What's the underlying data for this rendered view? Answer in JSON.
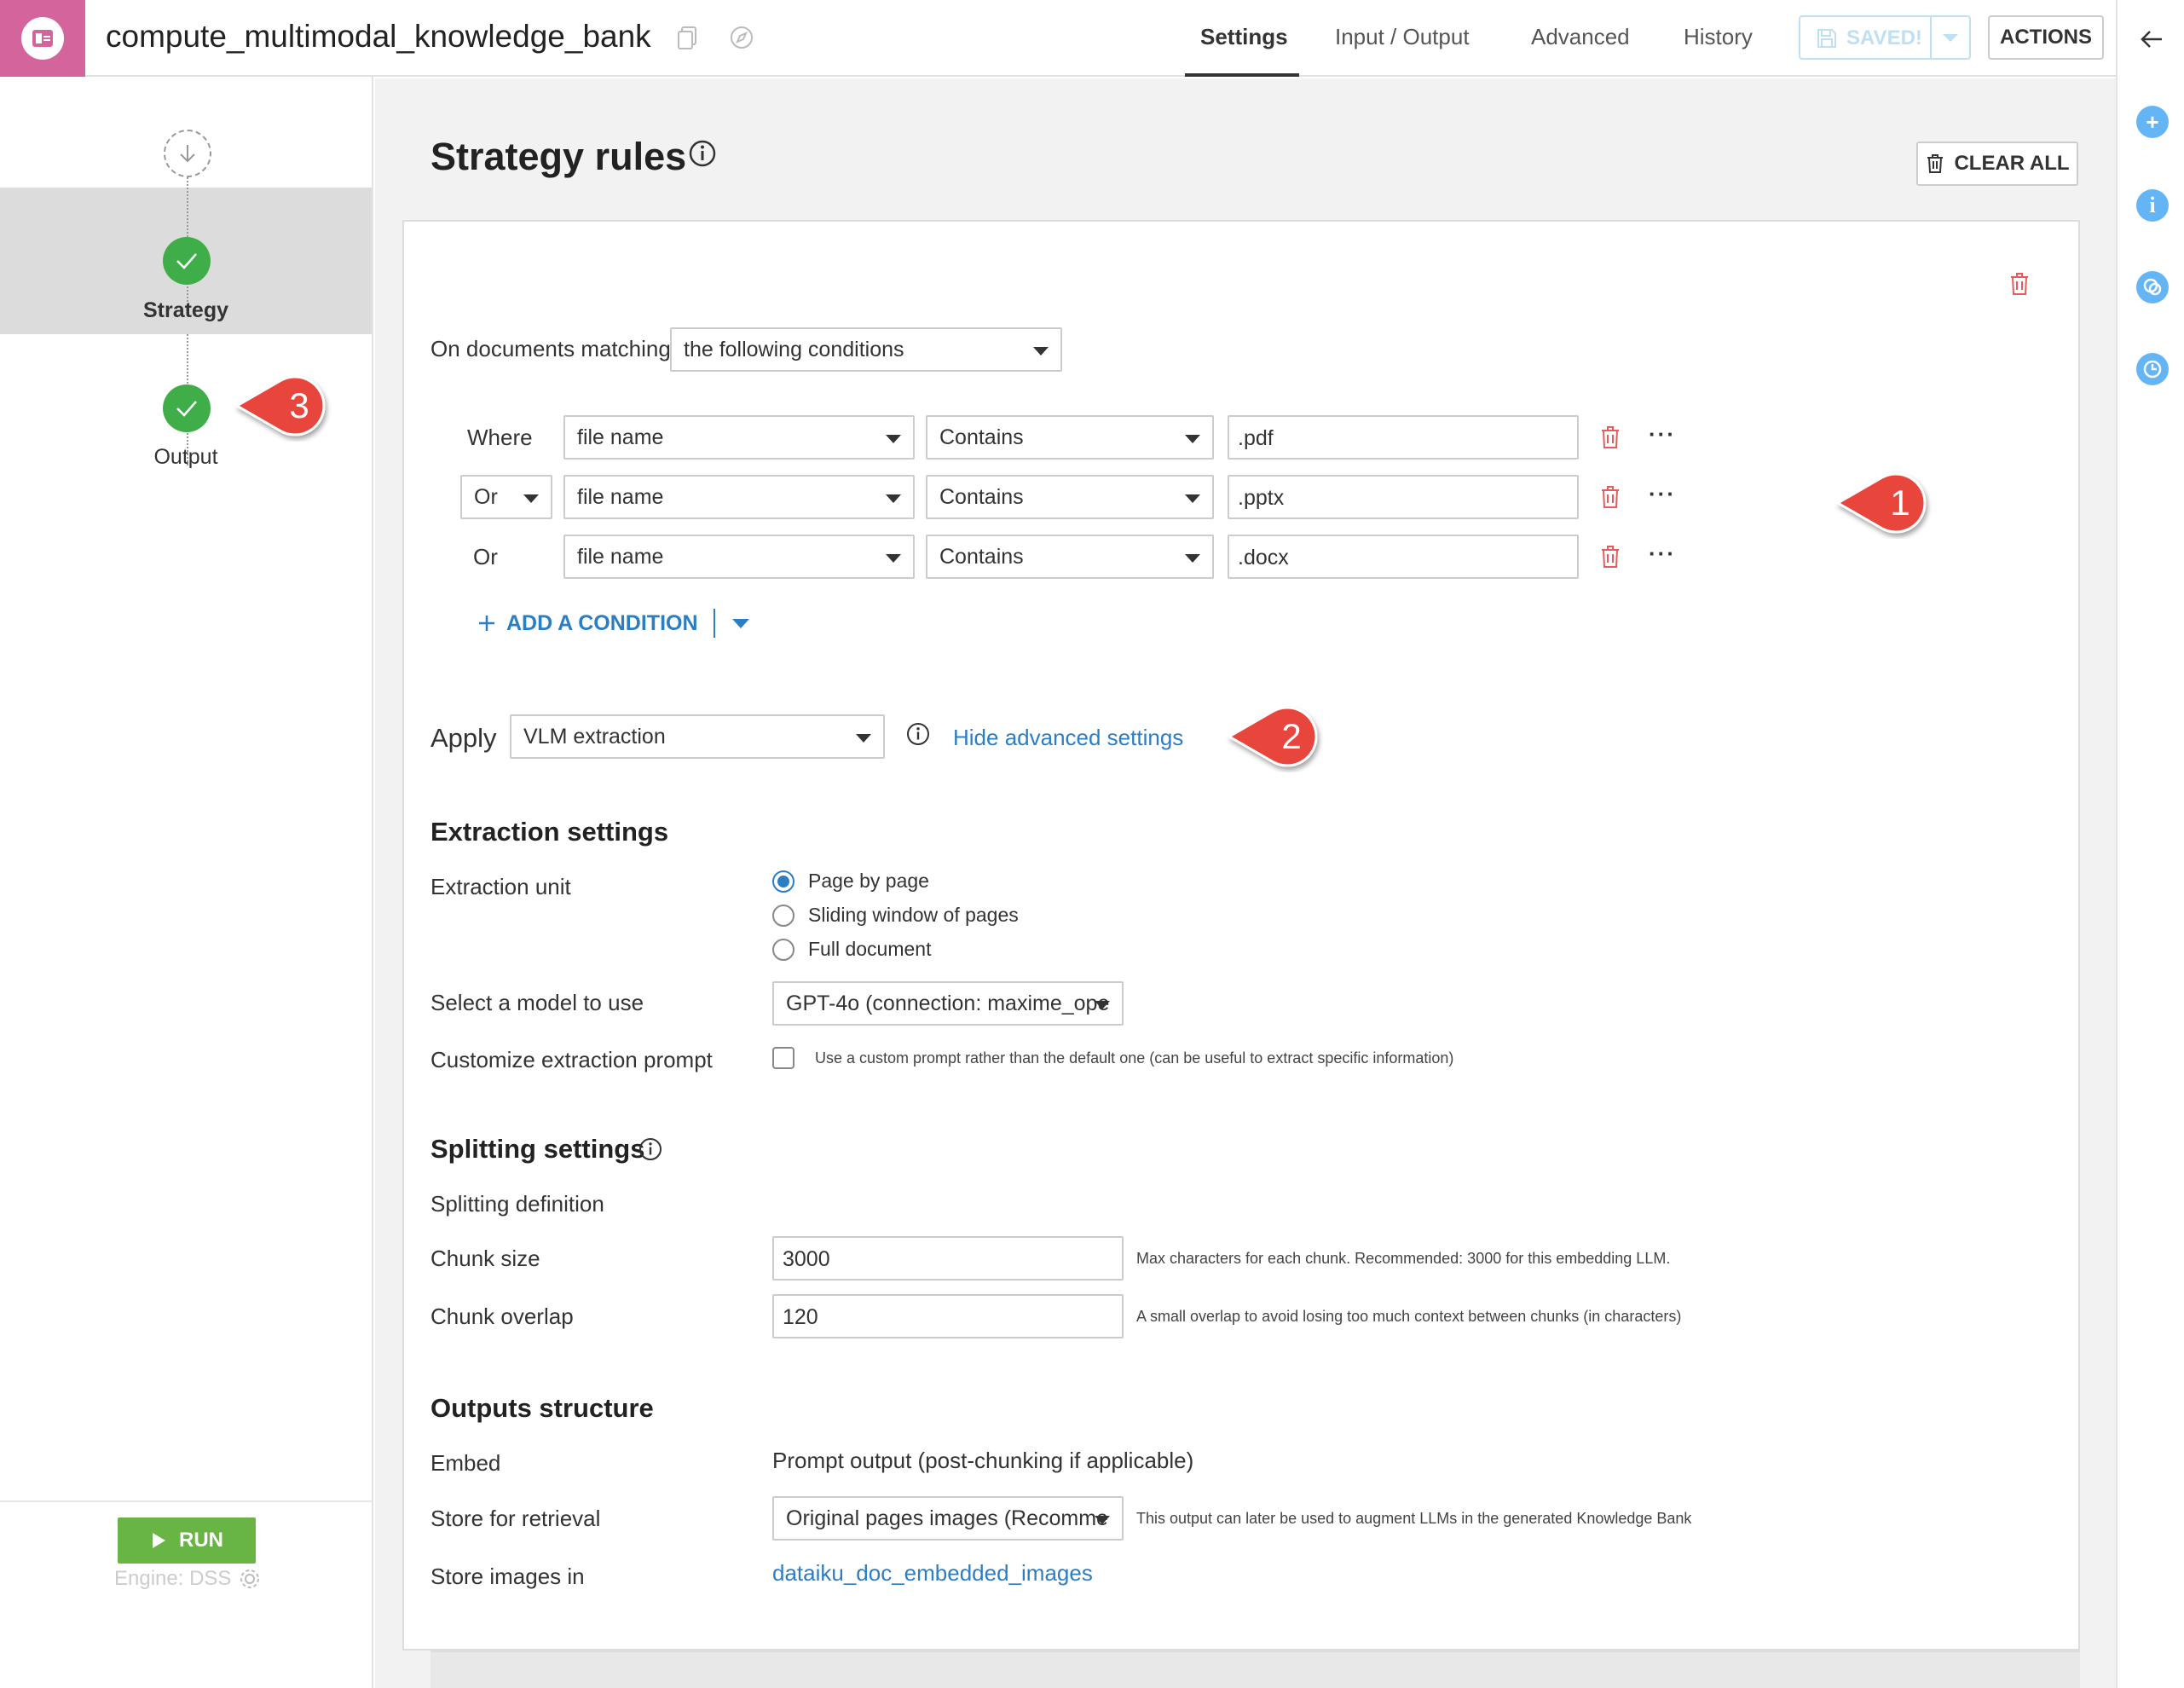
{
  "header": {
    "recipe_name": "compute_multimodal_knowledge_bank",
    "tabs": [
      {
        "label": "Settings"
      },
      {
        "label": "Input / Output"
      },
      {
        "label": "Advanced"
      },
      {
        "label": "History"
      }
    ],
    "saved_label": "SAVED!",
    "actions_label": "ACTIONS"
  },
  "left_panel": {
    "steps": [
      {
        "label": "Strategy"
      },
      {
        "label": "Output"
      }
    ],
    "run_label": "RUN",
    "engine_label": "Engine: DSS"
  },
  "main": {
    "title": "Strategy rules",
    "clear_all_label": "CLEAR ALL",
    "on_documents_label": "On documents matching",
    "matching_mode": "the following conditions",
    "conditions": [
      {
        "prefix": "Where",
        "field": "file name",
        "operator": "Contains",
        "value": ".pdf"
      },
      {
        "prefix": "Or",
        "field": "file name",
        "operator": "Contains",
        "value": ".pptx"
      },
      {
        "prefix": "Or",
        "field": "file name",
        "operator": "Contains",
        "value": ".docx"
      }
    ],
    "add_condition_label": "ADD A CONDITION",
    "apply_label": "Apply",
    "apply_value": "VLM extraction",
    "hide_advanced_label": "Hide advanced settings",
    "extraction": {
      "heading": "Extraction settings",
      "unit_label": "Extraction unit",
      "units": [
        "Page by page",
        "Sliding window of pages",
        "Full document"
      ],
      "selected_unit": "Page by page",
      "model_label": "Select a model to use",
      "model_value": "GPT-4o (connection: maxime_ope",
      "customize_label": "Customize extraction prompt",
      "customize_help": "Use a custom prompt rather than the default one (can be useful to extract specific information)",
      "customize_checked": false
    },
    "splitting": {
      "heading": "Splitting settings",
      "definition_label": "Splitting definition",
      "chunk_size_label": "Chunk size",
      "chunk_size_value": "3000",
      "chunk_size_help": "Max characters for each chunk. Recommended: 3000 for this embedding LLM.",
      "chunk_overlap_label": "Chunk overlap",
      "chunk_overlap_value": "120",
      "chunk_overlap_help": "A small overlap to avoid losing too much context between chunks (in characters)"
    },
    "outputs": {
      "heading": "Outputs structure",
      "embed_label": "Embed",
      "embed_value": "Prompt output (post-chunking if applicable)",
      "store_label": "Store for retrieval",
      "store_value": "Original pages images (Recomme",
      "store_help": "This output can later be used to augment LLMs in the generated Knowledge Bank",
      "images_label": "Store images in",
      "images_value": "dataiku_doc_embedded_images"
    }
  },
  "callouts": [
    "1",
    "2",
    "3"
  ],
  "colors": {
    "accent": "#2c7ec3",
    "success": "#3fae49",
    "run": "#68b444",
    "recipe_tile": "#d4659c",
    "danger": "#e35d5d",
    "callout": "#e8453c"
  }
}
